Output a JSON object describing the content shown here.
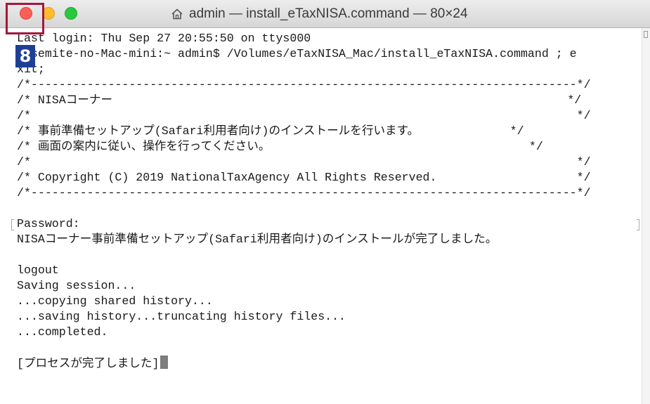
{
  "window": {
    "title": "admin — install_eTaxNISA.command — 80×24",
    "title_icon": "home-icon"
  },
  "overlay": {
    "step_number": "8",
    "highlight_color": "#a3183c",
    "badge_color": "#1f3f95"
  },
  "terminal": {
    "lines": [
      "Last login: Thu Sep 27 20:55:50 on ttys000",
      "Yosemite-no-Mac-mini:~ admin$ /Volumes/eTaxNISA_Mac/install_eTaxNISA.command ; e",
      "xit;",
      "/*------------------------------------------------------------------------------*/",
      "/* NISAコーナー                                                                 */",
      "/*                                                                              */",
      "/* 事前準備セットアップ(Safari利用者向け)のインストールを行います。             */",
      "/* 画面の案内に従い、操作を行ってください。                                     */",
      "/*                                                                              */",
      "/* Copyright (C) 2019 NationalTaxAgency All Rights Reserved.                    */",
      "/*------------------------------------------------------------------------------*/",
      "",
      "Password:",
      "NISAコーナー事前準備セットアップ(Safari利用者向け)のインストールが完了しました。",
      "",
      "logout",
      "Saving session...",
      "...copying shared history...",
      "...saving history...truncating history files...",
      "...completed.",
      "",
      "[プロセスが完了しました]"
    ]
  },
  "colors": {
    "traffic_close": "#fc5f57",
    "traffic_minimize": "#fdbc2e",
    "traffic_zoom": "#28c840",
    "cursor": "#7d7d7d"
  }
}
